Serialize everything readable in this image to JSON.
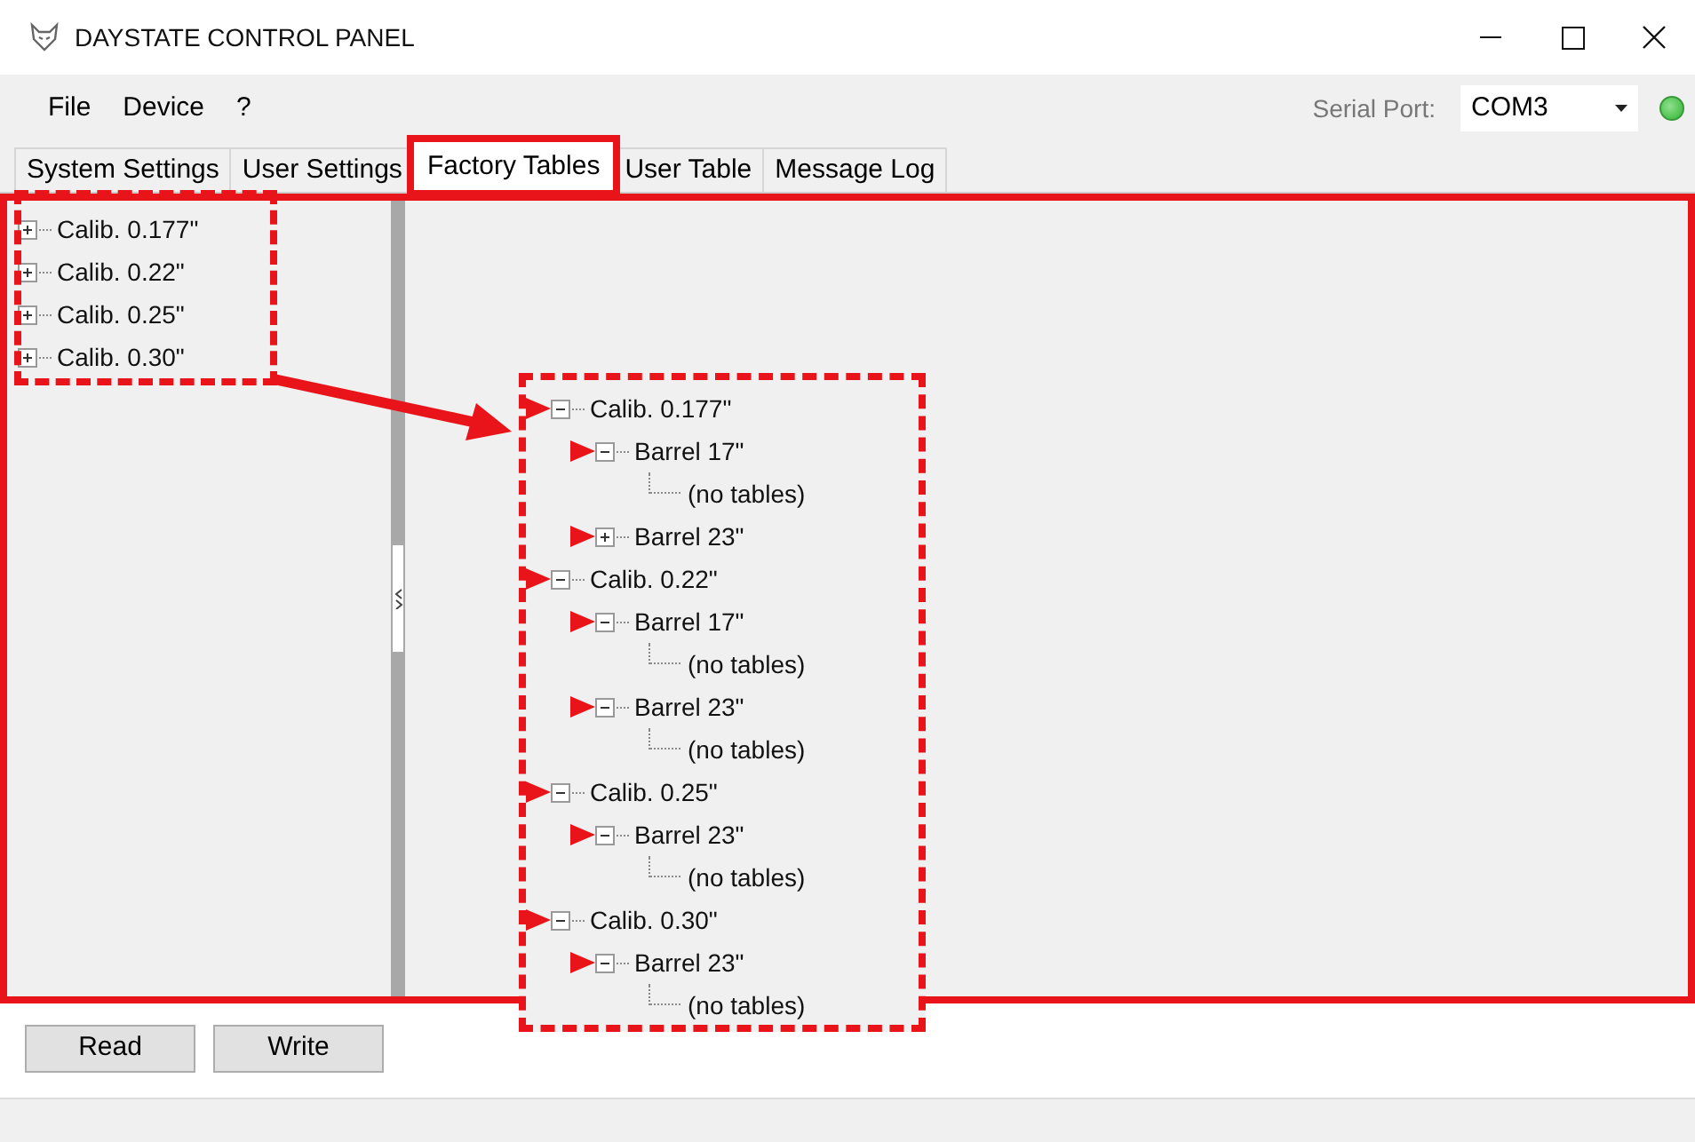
{
  "window": {
    "title": "DAYSTATE CONTROL PANEL"
  },
  "menu": [
    "File",
    "Device",
    "?"
  ],
  "serial_port": {
    "label": "Serial Port:",
    "value": "COM3",
    "connected": true
  },
  "tabs": [
    {
      "label": "System Settings",
      "selected": false
    },
    {
      "label": "User Settings",
      "selected": false
    },
    {
      "label": "Factory Tables",
      "selected": true
    },
    {
      "label": "User Table",
      "selected": false
    },
    {
      "label": "Message Log",
      "selected": false
    }
  ],
  "tree": [
    {
      "label": "Calib. 0.177\"",
      "expanded": false
    },
    {
      "label": "Calib. 0.22\"",
      "expanded": false
    },
    {
      "label": "Calib. 0.25\"",
      "expanded": false
    },
    {
      "label": "Calib. 0.30\"",
      "expanded": false
    }
  ],
  "callout_tree": [
    {
      "label": "Calib. 0.177\"",
      "expanded": true,
      "marked": true,
      "children": [
        {
          "label": "Barrel 17\"",
          "expanded": true,
          "marked": true,
          "children": [
            {
              "label": "(no tables)",
              "marked": false
            }
          ]
        },
        {
          "label": "Barrel 23\"",
          "expanded": false,
          "marked": true
        }
      ]
    },
    {
      "label": "Calib. 0.22\"",
      "expanded": true,
      "marked": true,
      "children": [
        {
          "label": "Barrel 17\"",
          "expanded": true,
          "marked": true,
          "children": [
            {
              "label": "(no tables)",
              "marked": false
            }
          ]
        },
        {
          "label": "Barrel 23\"",
          "expanded": true,
          "marked": true,
          "children": [
            {
              "label": "(no tables)",
              "marked": false
            }
          ]
        }
      ]
    },
    {
      "label": "Calib. 0.25\"",
      "expanded": true,
      "marked": true,
      "children": [
        {
          "label": "Barrel 23\"",
          "expanded": true,
          "marked": true,
          "children": [
            {
              "label": "(no tables)",
              "marked": false
            }
          ]
        }
      ]
    },
    {
      "label": "Calib. 0.30\"",
      "expanded": true,
      "marked": true,
      "children": [
        {
          "label": "Barrel 23\"",
          "expanded": true,
          "marked": true,
          "children": [
            {
              "label": "(no tables)",
              "marked": false
            }
          ]
        }
      ]
    }
  ],
  "buttons": [
    "Read",
    "Write"
  ]
}
